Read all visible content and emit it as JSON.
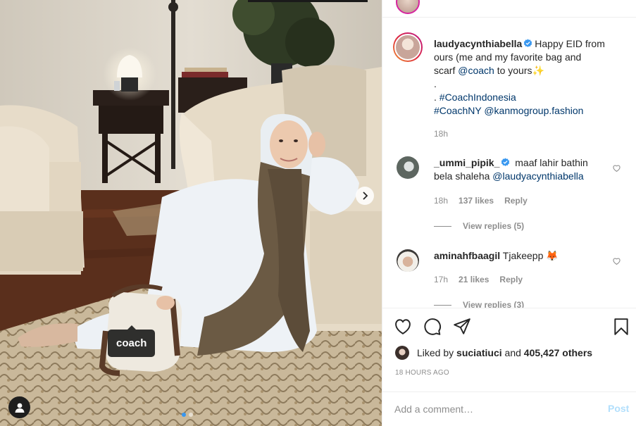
{
  "photo": {
    "tag_label": "coach",
    "carousel": {
      "count": 2,
      "active": 1
    }
  },
  "caption": {
    "username": "laudyacynthiabella",
    "text_line1": "Happy EID from",
    "text_line2": "ours (me and my favorite bag and",
    "text_line3_pre": "scarf",
    "text_line3_link": "@coach",
    "text_line3_post": "to yours",
    "text_line3_emoji": "✨",
    "dot_line": ".",
    "line5_pre": ". ",
    "line5_link": "#CoachIndonesia",
    "line6_link1": "#CoachNY",
    "line6_link2": "@kanmogroup.fashion",
    "time": "18h"
  },
  "comments": [
    {
      "username": "_ummi_pipik_",
      "text": "maaf lahir bathin",
      "text_line2_pre": "bela shaleha",
      "mention": "@laudyacynthiabella",
      "time": "18h",
      "likes": "137 likes",
      "reply_label": "Reply",
      "view_replies": "View replies (5)"
    },
    {
      "username": "aminahfbaagil",
      "text": "Tjakeepp",
      "emoji": "🦊",
      "time": "17h",
      "likes": "21 likes",
      "reply_label": "Reply",
      "view_replies": "View replies (3)"
    }
  ],
  "actions": {
    "liked_by_prefix": "Liked by",
    "liked_by_user": "suciatiuci",
    "liked_by_and": "and",
    "liked_by_others": "405,427 others",
    "timestamp": "18 HOURS AGO"
  },
  "comment_input": {
    "placeholder": "Add a comment…",
    "post_label": "Post"
  },
  "colors": {
    "accent_blue": "#3897f0",
    "link": "#00376b",
    "muted": "#8e8e8e",
    "post_disabled": "#b2dffc",
    "verified": "#3897f0"
  },
  "icons": [
    "heart-icon",
    "comment-icon",
    "share-icon",
    "save-icon",
    "verified-icon",
    "user-tag-icon",
    "chevron-right-icon"
  ]
}
